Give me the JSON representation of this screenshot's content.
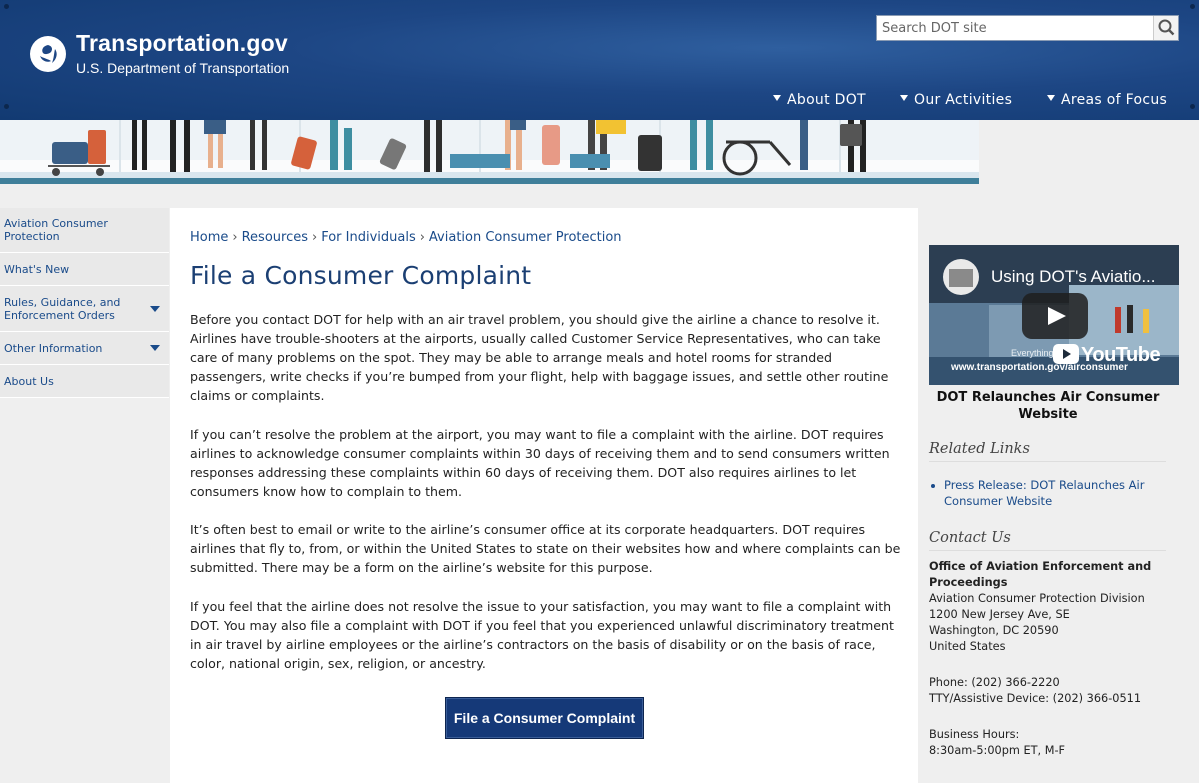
{
  "header": {
    "site_title": "Transportation.gov",
    "site_subtitle": "U.S. Department of Transportation",
    "search_placeholder": "Search DOT site",
    "nav": [
      "About DOT",
      "Our Activities",
      "Areas of Focus"
    ]
  },
  "sidebar": {
    "items": [
      {
        "label": "Aviation Consumer Protection",
        "expandable": false
      },
      {
        "label": "What's New",
        "expandable": false
      },
      {
        "label": "Rules, Guidance, and Enforcement Orders",
        "expandable": true
      },
      {
        "label": "Other Information",
        "expandable": true
      },
      {
        "label": "About Us",
        "expandable": false
      }
    ]
  },
  "breadcrumb": [
    "Home",
    "Resources",
    "For Individuals",
    "Aviation Consumer Protection"
  ],
  "main": {
    "title": "File a Consumer Complaint",
    "paragraphs": [
      "Before you contact DOT for help with an air travel problem, you should give the airline a chance to resolve it.  Airlines have trouble-shooters at the airports, usually called Customer Service Representatives, who can take care of many problems on the spot.  They may be able to arrange meals and hotel rooms for stranded passengers, write checks if you’re bumped from your flight, help with baggage issues, and settle other routine claims or complaints.",
      "If you can’t resolve the problem at the airport, you may want to file a complaint with the airline.  DOT requires airlines to acknowledge consumer complaints within 30 days of receiving them and to send consumers written responses addressing these complaints within 60 days of receiving them.  DOT also requires airlines to let consumers know how to complain to them.",
      "It’s often best to email or write to the airline’s consumer office at its corporate headquarters.  DOT requires airlines that fly to, from, or within the United States to state on their websites how and where complaints can be submitted.  There may be a form on the airline’s website for this purpose.",
      "If you feel that the airline does not resolve the issue to your satisfaction, you may want to file a complaint with DOT.  You may also file a complaint with DOT if you feel that you experienced unlawful discriminatory treatment in air travel by airline employees or the airline’s contractors on the basis of disability or on the basis of race, color, national origin, sex, religion, or ancestry."
    ],
    "button_label": "File a Consumer Complaint"
  },
  "right": {
    "video_title": "Using DOT's Aviatio...",
    "video_brand": "YouTube",
    "video_overlay_line1": "Everything You",
    "video_overlay_line2": "www.transportation.gov/airconsumer",
    "video_caption": "DOT Relaunches Air Consumer Website",
    "related_heading": "Related Links",
    "related_links": [
      "Press Release: DOT Relaunches Air Consumer Website"
    ],
    "contact_heading": "Contact Us",
    "contact": {
      "org": "Office of Aviation Enforcement and Proceedings",
      "division": "Aviation Consumer Protection Division",
      "address1": "1200 New Jersey Ave, SE",
      "address2": "Washington, DC 20590",
      "country": "United States",
      "phone": "Phone: (202) 366-2220",
      "tty": "TTY/Assistive Device: (202) 366-0511",
      "hours_label": "Business Hours:",
      "hours": "8:30am-5:00pm ET, M-F"
    }
  },
  "colors": {
    "header_blue": "#1d4684",
    "link_blue": "#1a4b8a",
    "title_blue": "#1b3f73",
    "button_blue": "#153978"
  }
}
